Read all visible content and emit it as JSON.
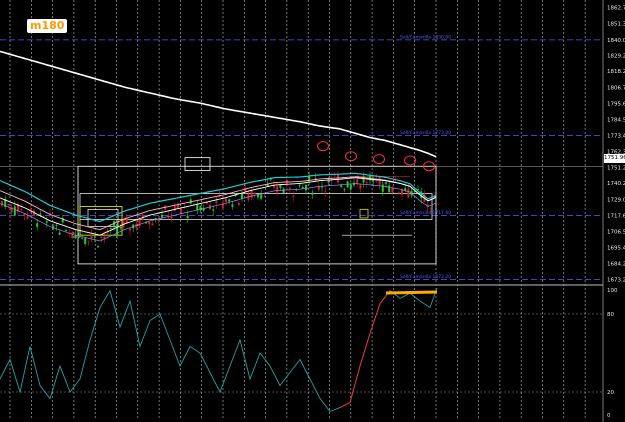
{
  "timeframe_badge": "m180",
  "last_price_label": "1751.96",
  "colors": {
    "background": "#000000",
    "grid": "#ffffff",
    "pivot_line": "#5a5aff",
    "ma_slow": "#ffffff",
    "ma_cyan": "#22c8d8",
    "ma_pink": "#ffb0c8",
    "oscillator": "#22a0a8",
    "oscillator_hot": "#ff2a2a",
    "bull_candle": "#22cc22",
    "bear_candle": "#cc2222",
    "markers": "#ff3030",
    "highlight": "#ffaa00"
  },
  "chart_data": [
    {
      "type": "line",
      "title": "",
      "price_axis_ticks": [
        "1862.70",
        "1851.30",
        "1840.00",
        "1829.20",
        "1818.20",
        "1806.70",
        "1795.60",
        "1784.50",
        "1773.40",
        "1762.30",
        "1751.20",
        "1740.20",
        "1729.00",
        "1717.60",
        "1706.50",
        "1695.40",
        "1684.20",
        "1673.20"
      ],
      "ylim": [
        1670,
        1865
      ],
      "pivot_lines": [
        {
          "price": 1840.0,
          "label": "Sell/Camarilla 1830.00"
        },
        {
          "price": 1773.4,
          "label": "Sell/Camarilla 1773.00"
        },
        {
          "price": 1717.6,
          "label": "Sell/Camarilla 1717.60"
        },
        {
          "price": 1673.2,
          "label": "Sell/Camarilla 1673.20"
        }
      ],
      "series": [
        {
          "values": [
            1832,
            1827,
            1822,
            1817,
            1812,
            1807,
            1803,
            1799,
            1796,
            1792,
            1789,
            1786,
            1783,
            1780,
            1778,
            1775,
            1772,
            1770,
            1767,
            1765,
            1763,
            1761,
            1759,
            1757,
            1755,
            1754,
            1753
          ]
        },
        {
          "values": [
            1728,
            1721,
            1712,
            1706,
            1702,
            1710,
            1716,
            1720,
            1724,
            1728,
            1733,
            1737,
            1738,
            1740,
            1741,
            1742,
            1741,
            1740,
            1738,
            1736,
            1730,
            1726,
            1728,
            1733,
            1738,
            1744,
            1748
          ]
        }
      ],
      "price_x": [
        0,
        25,
        50,
        75,
        100,
        125,
        150,
        175,
        200,
        225,
        250,
        275,
        300,
        320,
        340,
        355,
        370,
        385,
        400,
        410,
        420,
        428,
        435,
        440,
        445,
        450,
        455
      ],
      "markers": [
        {
          "x": 323,
          "price": 1766
        },
        {
          "x": 351,
          "price": 1759
        },
        {
          "x": 379,
          "price": 1757
        },
        {
          "x": 410,
          "price": 1756
        },
        {
          "x": 429,
          "price": 1752
        }
      ]
    },
    {
      "type": "line",
      "title": "",
      "yticks": [
        "100",
        "80",
        "20",
        "0"
      ],
      "ylim": [
        0,
        100
      ],
      "x": [
        0,
        10,
        20,
        30,
        40,
        50,
        60,
        70,
        80,
        90,
        100,
        110,
        120,
        130,
        140,
        150,
        160,
        170,
        180,
        190,
        200,
        210,
        220,
        230,
        240,
        250,
        260,
        270,
        280,
        290,
        300,
        310,
        320,
        330,
        340,
        350,
        360,
        370,
        380,
        390,
        400,
        410,
        420,
        430,
        437
      ],
      "values": [
        30,
        45,
        20,
        55,
        25,
        15,
        40,
        20,
        30,
        60,
        85,
        98,
        70,
        90,
        55,
        75,
        80,
        60,
        40,
        55,
        50,
        35,
        20,
        40,
        60,
        30,
        50,
        40,
        25,
        35,
        45,
        30,
        15,
        5,
        8,
        12,
        40,
        65,
        88,
        98,
        92,
        96,
        90,
        85,
        100
      ],
      "hot_from_x": 340,
      "hot_to_x": 395,
      "highlight_level": 100
    }
  ]
}
